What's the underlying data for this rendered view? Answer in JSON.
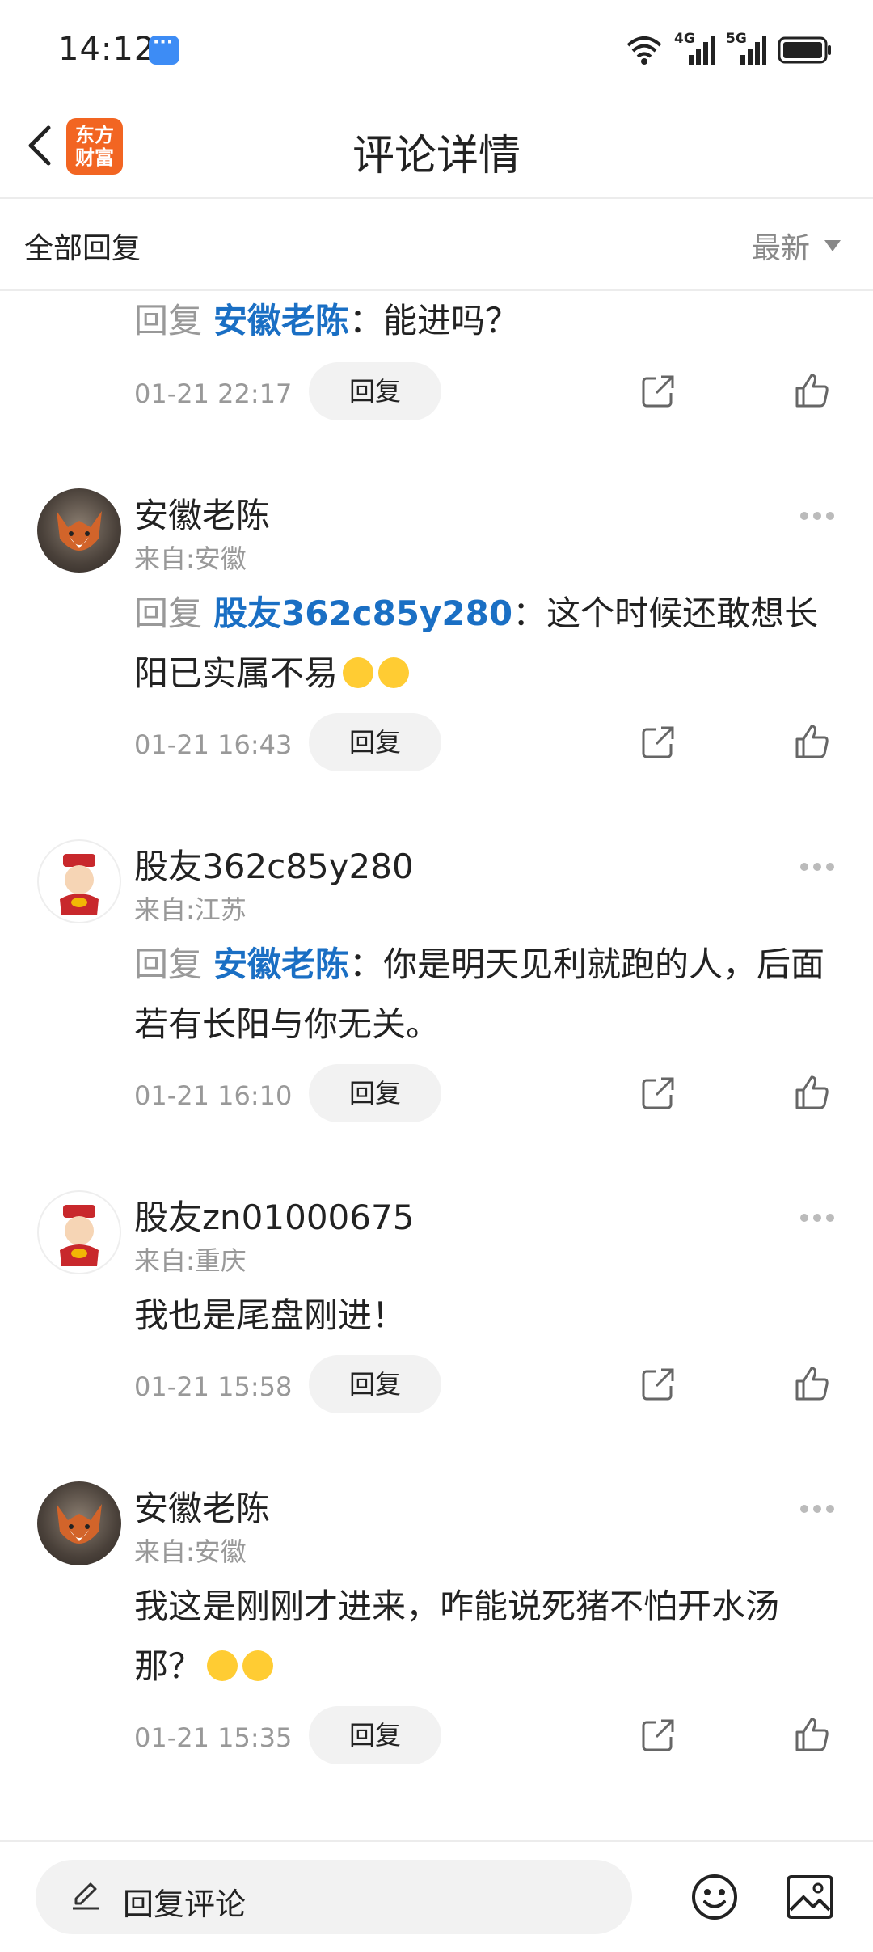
{
  "status_bar": {
    "time": "14:12",
    "signal_labels": [
      "4G",
      "5G"
    ]
  },
  "nav": {
    "title": "评论详情",
    "logo_text": "东方财富"
  },
  "filter": {
    "label": "全部回复",
    "sort": "最新"
  },
  "reply_prefix": "回复",
  "reply_button": "回复",
  "comments": [
    {
      "mention": "安徽老陈",
      "text": "：能进吗？",
      "time": "01-21 22:17"
    },
    {
      "user": "安徽老陈",
      "from": "来自:安徽",
      "mention": "股友362c85y280",
      "text": "：这个时候还敢想长阳已实属不易",
      "time": "01-21 16:43"
    },
    {
      "user": "股友362c85y280",
      "from": "来自:江苏",
      "mention": "安徽老陈",
      "text": "：你是明天见利就跑的人，后面若有长阳与你无关。",
      "time": "01-21 16:10"
    },
    {
      "user": "股友zn01000675",
      "from": "来自:重庆",
      "text": "我也是尾盘刚进！",
      "time": "01-21 15:58"
    },
    {
      "user": "安徽老陈",
      "from": "来自:安徽",
      "text": "我这是刚刚才进来，咋能说死猪不怕开水汤那？",
      "time": "01-21 15:35"
    }
  ],
  "bottom": {
    "placeholder": "回复评论"
  },
  "colors": {
    "mention": "#1a6fc4",
    "logo": "#f26522",
    "emoji": "#ffcc33"
  }
}
